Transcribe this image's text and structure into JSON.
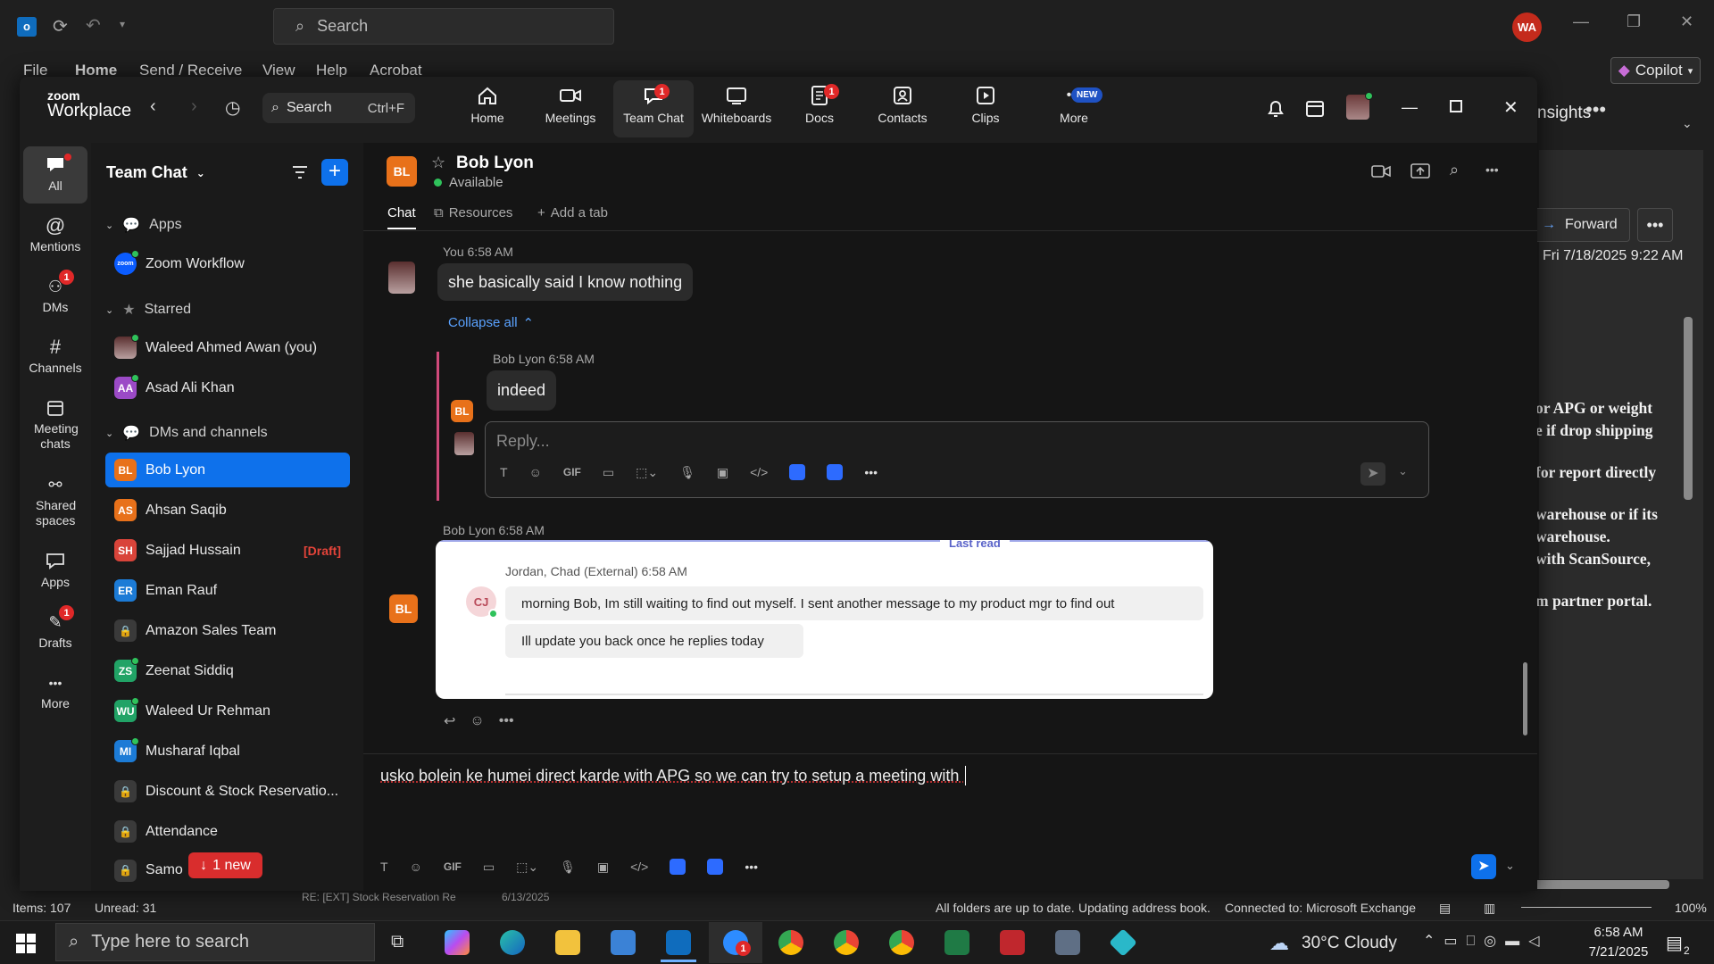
{
  "outlook": {
    "search_placeholder": "Search",
    "menu": [
      "File",
      "Home",
      "Send / Receive",
      "View",
      "Help",
      "Acrobat"
    ],
    "avatar": "WA",
    "copilot": "Copilot",
    "insights": "nsights",
    "forward": "Forward",
    "date": "Fri 7/18/2025 9:22 AM",
    "reading_lines": [
      "or APG or weight",
      "e if drop shipping",
      "for report directly",
      "warehouse or if its",
      "warehouse.",
      "with ScanSource,",
      "m partner portal."
    ],
    "status": {
      "items": "Items: 107",
      "unread": "Unread: 31",
      "subject": "RE: [EXT] Stock Reservation Re",
      "date": "6/13/2025",
      "sync": "All folders are up to date.",
      "updating": "Updating address book.",
      "connected": "Connected to: Microsoft Exchange",
      "zoom": "100%"
    }
  },
  "zoom": {
    "brand_top": "zoom",
    "brand_bottom": "Workplace",
    "search": "Search",
    "search_shortcut": "Ctrl+F",
    "tabs": [
      {
        "label": "Home"
      },
      {
        "label": "Meetings"
      },
      {
        "label": "Team Chat",
        "badge": "1"
      },
      {
        "label": "Whiteboards"
      },
      {
        "label": "Docs",
        "badge": "1"
      },
      {
        "label": "Contacts"
      },
      {
        "label": "Clips"
      },
      {
        "label": "More",
        "badge": "NEW"
      }
    ],
    "rail": [
      {
        "label": "All"
      },
      {
        "label": "Mentions"
      },
      {
        "label": "DMs",
        "badge": "1"
      },
      {
        "label": "Channels"
      },
      {
        "label": "Meeting chats"
      },
      {
        "label": "Shared spaces"
      },
      {
        "label": "Apps"
      },
      {
        "label": "Drafts",
        "badge": "1"
      },
      {
        "label": "More"
      }
    ]
  },
  "sidebar": {
    "title": "Team Chat",
    "apps_header": "Apps",
    "apps": [
      "Zoom Workflow"
    ],
    "starred_header": "Starred",
    "starred": [
      {
        "name": "Waleed Ahmed Awan (you)",
        "initials": ""
      },
      {
        "name": "Asad Ali Khan",
        "initials": "AA"
      }
    ],
    "dms_header": "DMs and channels",
    "dms": [
      {
        "name": "Bob Lyon",
        "initials": "BL",
        "color": "#e8711a"
      },
      {
        "name": "Ahsan Saqib",
        "initials": "AS",
        "color": "#e8711a"
      },
      {
        "name": "Sajjad Hussain",
        "initials": "SH",
        "color": "#d9443a",
        "tag": "[Draft]"
      },
      {
        "name": "Eman Rauf",
        "initials": "ER",
        "color": "#1c7bd6"
      },
      {
        "name": "Amazon Sales Team",
        "initials": "",
        "color": ""
      },
      {
        "name": "Zeenat Siddiq",
        "initials": "ZS",
        "color": "#21a366"
      },
      {
        "name": "Waleed Ur Rehman",
        "initials": "WU",
        "color": "#21a366"
      },
      {
        "name": "Musharaf Iqbal",
        "initials": "MI",
        "color": "#1c7bd6"
      },
      {
        "name": "Discount & Stock Reservatio...",
        "initials": "",
        "color": ""
      },
      {
        "name": "Attendance",
        "initials": "",
        "color": ""
      },
      {
        "name": "Samo",
        "initials": "",
        "color": ""
      }
    ],
    "new_pill": "1 new"
  },
  "chat": {
    "contact_initials": "BL",
    "contact": "Bob Lyon",
    "presence": "Available",
    "tabs": [
      "Chat",
      "Resources",
      "Add a tab"
    ],
    "msg1": {
      "meta": "You 6:58 AM",
      "text": "she basically said I know nothing"
    },
    "collapse": "Collapse all",
    "reply1": {
      "meta": "Bob Lyon 6:58 AM",
      "initials": "BL",
      "text": "indeed"
    },
    "reply_placeholder": "Reply...",
    "msg2": {
      "meta": "Bob Lyon 6:58 AM",
      "initials": "BL"
    },
    "last_read": "Last read",
    "quote": {
      "initials": "CJ",
      "meta": "Jordan, Chad (External)  6:58 AM",
      "line1": "morning Bob, Im still waiting to find out myself.  I sent another message to my product mgr to find out",
      "line2": "Ill update you back once he replies today"
    },
    "compose_text": "usko bolein ke humei direct karde with APG so we can try to setup a meeting with "
  },
  "taskbar": {
    "search": "Type here to search",
    "weather": "30°C  Cloudy",
    "time": "6:58 AM",
    "date": "7/21/2025",
    "zoom_badge": "1",
    "notif": "2"
  }
}
